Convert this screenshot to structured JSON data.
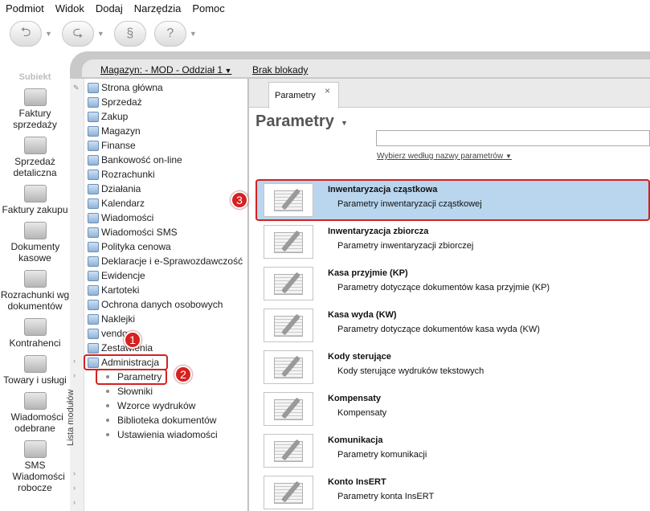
{
  "menu": [
    "Podmiot",
    "Widok",
    "Dodaj",
    "Narzędzia",
    "Pomoc"
  ],
  "toolbar": {
    "icons": [
      "back-icon",
      "forward-icon",
      "module-icon",
      "help-icon"
    ]
  },
  "logo": "Subiekt",
  "left_nav": [
    {
      "label": "Faktury sprzedaży",
      "icon": "invoices-icon"
    },
    {
      "label": "Sprzedaż detaliczna",
      "icon": "retail-icon"
    },
    {
      "label": "Faktury zakupu",
      "icon": "purchase-invoices-icon"
    },
    {
      "label": "Dokumenty kasowe",
      "icon": "cash-documents-icon"
    },
    {
      "label": "Rozrachunki wg dokumentów",
      "icon": "settlements-icon"
    },
    {
      "label": "Kontrahenci",
      "icon": "contractors-icon"
    },
    {
      "label": "Towary i usługi",
      "icon": "goods-icon"
    },
    {
      "label": "Wiadomości odebrane",
      "icon": "inbox-icon"
    },
    {
      "label": "SMS Wiadomości robocze",
      "icon": "sms-icon"
    }
  ],
  "header": {
    "warehouse": "Magazyn: - MOD - Oddział 1",
    "locks": "Brak blokady"
  },
  "modules_label": "Lista modułów",
  "modules": [
    "Strona główna",
    "Sprzedaż",
    "Zakup",
    "Magazyn",
    "Finanse",
    "Bankowość on-line",
    "Rozrachunki",
    "Działania",
    "Kalendarz",
    "Wiadomości",
    "Wiadomości SMS",
    "Polityka cenowa",
    "Deklaracje i e-Sprawozdawczość",
    "Ewidencje",
    "Kartoteki",
    "Ochrona danych osobowych",
    "Naklejki",
    "vendo",
    "Zestawienia",
    "Administracja"
  ],
  "submodules": [
    "Parametry",
    "Słowniki",
    "Wzorce wydruków",
    "Biblioteka dokumentów",
    "Ustawienia wiadomości"
  ],
  "tab": {
    "label": "Parametry",
    "close": "×"
  },
  "page": {
    "title": "Parametry",
    "search_hint": "Wybierz według nazwy parametrów"
  },
  "params": [
    {
      "title": "Inwentaryzacja cząstkowa",
      "desc": "Parametry inwentaryzacji cząstkowej"
    },
    {
      "title": "Inwentaryzacja zbiorcza",
      "desc": "Parametry inwentaryzacji zbiorczej"
    },
    {
      "title": "Kasa przyjmie (KP)",
      "desc": "Parametry dotyczące dokumentów kasa przyjmie (KP)"
    },
    {
      "title": "Kasa wyda (KW)",
      "desc": "Parametry dotyczące dokumentów kasa wyda (KW)"
    },
    {
      "title": "Kody sterujące",
      "desc": "Kody sterujące wydruków tekstowych"
    },
    {
      "title": "Kompensaty",
      "desc": "Kompensaty"
    },
    {
      "title": "Komunikacja",
      "desc": "Parametry komunikacji"
    },
    {
      "title": "Konto InsERT",
      "desc": "Parametry konta InsERT"
    }
  ],
  "callouts": [
    "1",
    "2",
    "3"
  ],
  "colors": {
    "highlight": "#b9d6ee",
    "callout": "#d42121"
  }
}
